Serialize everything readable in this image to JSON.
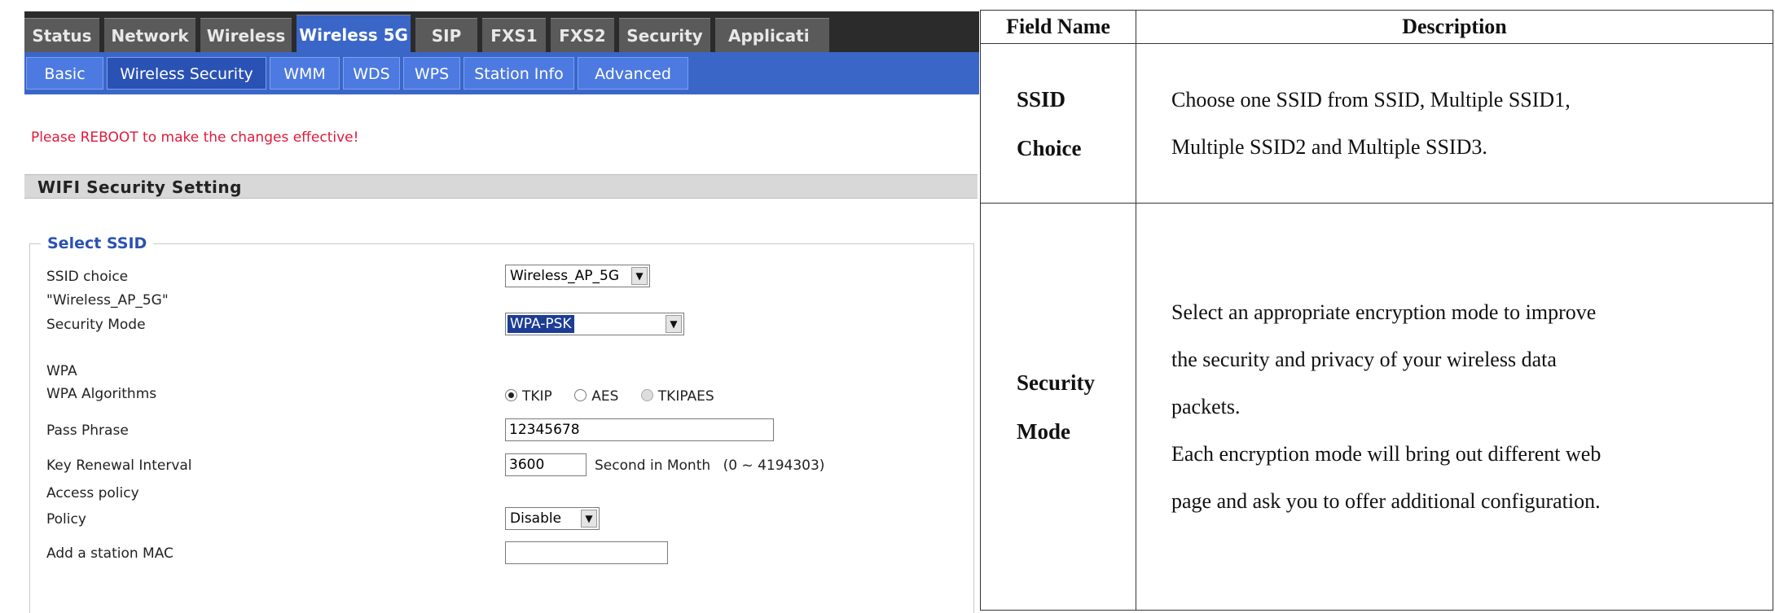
{
  "main_tabs": [
    "Status",
    "Network",
    "Wireless",
    "Wireless 5G",
    "SIP",
    "FXS1",
    "FXS2",
    "Security",
    "Applicati"
  ],
  "active_main_tab": "Wireless 5G",
  "sub_tabs": [
    "Basic",
    "Wireless Security",
    "WMM",
    "WDS",
    "WPS",
    "Station Info",
    "Advanced"
  ],
  "active_sub_tab": "Wireless Security",
  "reboot_notice": "Please REBOOT to make the changes effective!",
  "section_title": "WIFI Security Setting",
  "select_ssid": {
    "legend": "Select SSID",
    "ssid_choice_label": "SSID choice",
    "ssid_choice_value": "Wireless_AP_5G",
    "ssid_quoted": "\"Wireless_AP_5G\"",
    "security_mode_label": "Security Mode",
    "security_mode_value": "WPA-PSK",
    "wpa_label": "WPA",
    "wpa_algorithms_label": "WPA Algorithms",
    "alg_options": [
      "TKIP",
      "AES",
      "TKIPAES"
    ],
    "alg_selected": "TKIP",
    "pass_phrase_label": "Pass Phrase",
    "pass_phrase_value": "12345678",
    "key_renewal_label": "Key Renewal Interval",
    "key_renewal_value": "3600",
    "key_renewal_unit": "Second in Month",
    "key_renewal_range": "(0 ~ 4194303)",
    "access_policy_label": "Access policy",
    "policy_label": "Policy",
    "policy_value": "Disable",
    "add_mac_label": "Add a station MAC",
    "add_mac_value": ""
  },
  "table": {
    "headers": [
      "Field Name",
      "Description"
    ],
    "rows": [
      {
        "name_lines": [
          "SSID",
          "Choice"
        ],
        "desc_lines": [
          "Choose one SSID from SSID, Multiple SSID1,",
          "Multiple SSID2 and Multiple SSID3."
        ]
      },
      {
        "name_lines": [
          "Security",
          "Mode"
        ],
        "desc_lines": [
          "Select an appropriate encryption mode to improve",
          "the security and privacy of your wireless data",
          "packets.",
          "Each encryption mode will bring out different web",
          "page and ask you to offer additional configuration."
        ]
      }
    ]
  },
  "colors": {
    "tab_blue": "#3a66c8",
    "notice_red": "#e0193a",
    "dark_bar": "#2b2b2b"
  }
}
